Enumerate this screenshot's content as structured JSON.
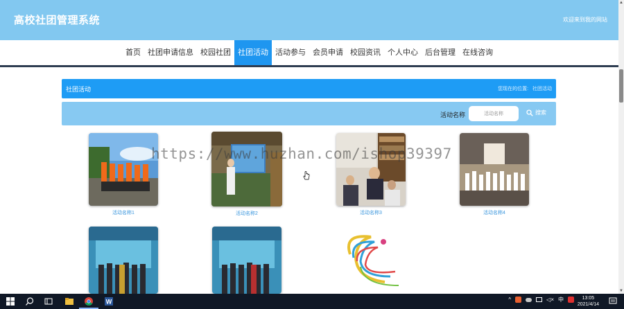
{
  "header": {
    "site_title": "高校社团管理系统",
    "welcome": "欢迎来到我的网站"
  },
  "nav": {
    "items": [
      {
        "label": "首页"
      },
      {
        "label": "社团申请信息"
      },
      {
        "label": "校园社团"
      },
      {
        "label": "社团活动",
        "active": true
      },
      {
        "label": "活动参与"
      },
      {
        "label": "会员申请"
      },
      {
        "label": "校园资讯"
      },
      {
        "label": "个人中心"
      },
      {
        "label": "后台管理"
      },
      {
        "label": "在线咨询"
      }
    ]
  },
  "section": {
    "title": "社团活动",
    "crumb_prefix": "您现在的位置:",
    "crumb_current": "社团活动"
  },
  "search": {
    "label": "活动名称",
    "placeholder": "活动名称",
    "button_label": "搜索"
  },
  "activities": [
    {
      "name": "活动名称1"
    },
    {
      "name": "活动名称2"
    },
    {
      "name": "活动名称3"
    },
    {
      "name": "活动名称4"
    },
    {
      "name": ""
    },
    {
      "name": ""
    },
    {
      "name": ""
    }
  ],
  "watermark": "https://www.huzhan.com/ishop39397",
  "taskbar": {
    "ime_label": "中",
    "clock_time": "13:05",
    "clock_date": "2021/4/14"
  },
  "colors": {
    "header_bg": "#82c8f0",
    "nav_active": "#1e96f0",
    "section_bar": "#1e9cf5",
    "search_row": "#87c9f2",
    "caption": "#3a96dd"
  }
}
